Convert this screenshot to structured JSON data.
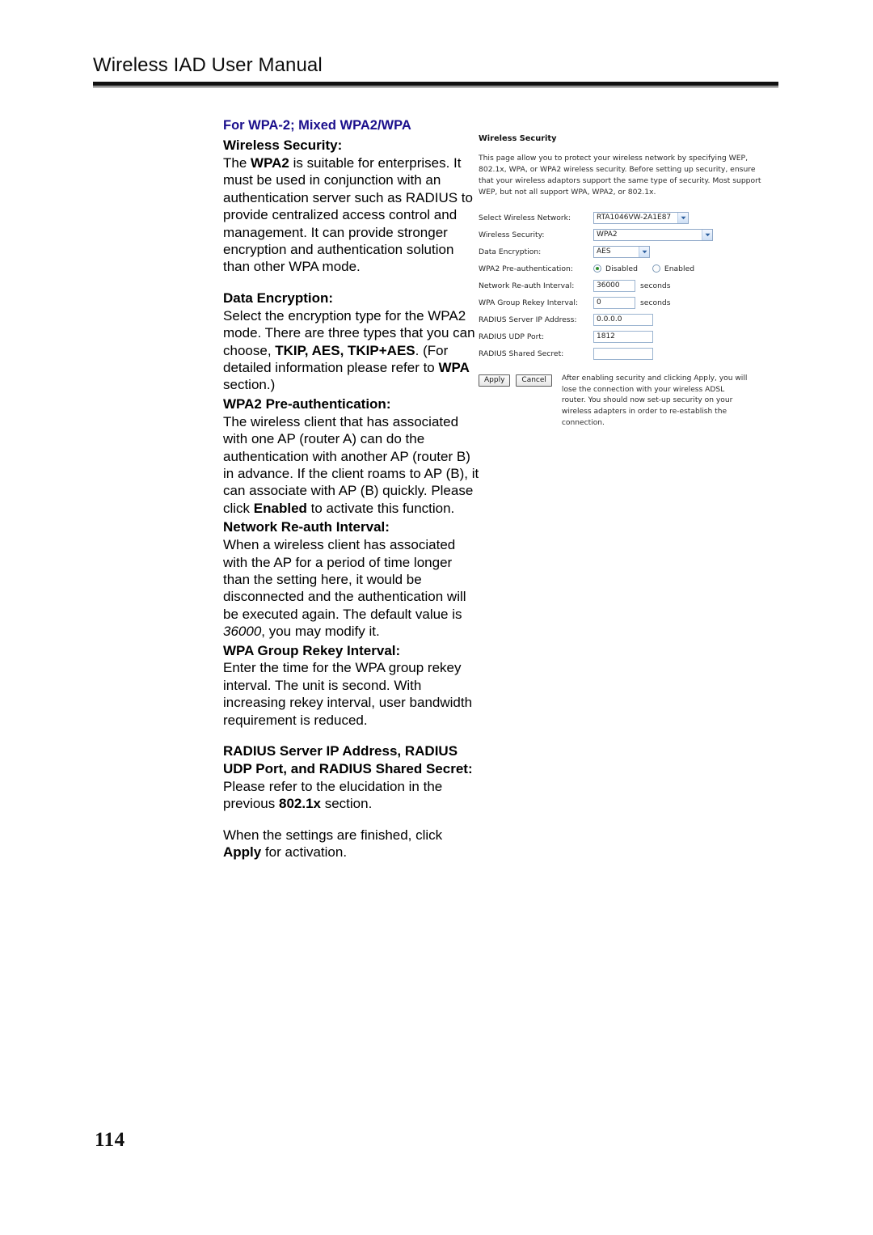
{
  "header": {
    "title": "Wireless IAD User Manual"
  },
  "page_number": "114",
  "doc": {
    "section_title": "For WPA-2; Mixed WPA2/WPA",
    "blocks": [
      {
        "heading": "Wireless Security:",
        "body_html": "The <b>WPA2</b> is suitable for enterprises. It must be used in conjunction with an authentication server such as RADIUS to provide centralized access control and management. It can provide stronger encryption and authentication solution than other WPA mode."
      },
      {
        "heading": "Data Encryption:",
        "body_html": "Select the encryption type for the WPA2 mode. There are three types that you can choose, <b>TKIP, AES, TKIP+AES</b>. (For detailed information please refer to <b>WPA</b> section.)"
      },
      {
        "heading": "WPA2 Pre-authentication:",
        "body_html": "The wireless client that has associated with one AP (router A) can do the authentication with another AP (router B) in advance. If the client roams to AP (B), it can associate with AP (B) quickly. Please click <b>Enabled</b> to activate this function."
      },
      {
        "heading": "Network Re-auth Interval:",
        "body_html": "When a wireless client has associated with the AP for a period of time longer than the setting here, it would be disconnected and the authentication will be executed again. The default value is <i>36000</i>, you may modify it."
      },
      {
        "heading": "WPA Group Rekey Interval:",
        "heading_colon_plain": true,
        "body_html": "Enter the time for the WPA group rekey interval. The unit is second. With increasing rekey interval, user bandwidth requirement is reduced."
      },
      {
        "heading": "RADIUS Server IP Address, RADIUS UDP Port, and RADIUS Shared Secret:",
        "heading_html": "<b>RADIUS Server IP Address, RADIUS UDP Port,</b> and <b>RADIUS Shared Secret:</b>",
        "body_html": "Please refer to the elucidation in the previous <b>802.1x</b> section."
      },
      {
        "heading": "",
        "body_html": "When the settings are finished, click <b>Apply</b> for activation."
      }
    ]
  },
  "screenshot": {
    "title": "Wireless Security",
    "intro": "This page allow you to protect your wireless network by specifying WEP, 802.1x, WPA, or WPA2 wireless security. Before setting up security, ensure that your wireless adaptors support the same type of security. Most support WEP, but not all support WPA, WPA2, or 802.1x.",
    "fields": {
      "select_network": {
        "label": "Select Wireless Network:",
        "value": "RTA1046VW-2A1E87"
      },
      "wireless_security": {
        "label": "Wireless Security:",
        "value": "WPA2"
      },
      "data_encryption": {
        "label": "Data Encryption:",
        "value": "AES"
      },
      "pre_auth": {
        "label": "WPA2 Pre-authentication:",
        "option_disabled": "Disabled",
        "option_enabled": "Enabled",
        "selected": "Disabled"
      },
      "reauth_interval": {
        "label": "Network Re-auth Interval:",
        "value": "36000",
        "unit": "seconds"
      },
      "group_rekey": {
        "label": "WPA Group Rekey Interval:",
        "value": "0",
        "unit": "seconds"
      },
      "radius_ip": {
        "label": "RADIUS Server IP Address:",
        "value": "0.0.0.0"
      },
      "radius_port": {
        "label": "RADIUS UDP Port:",
        "value": "1812"
      },
      "radius_secret": {
        "label": "RADIUS Shared Secret:",
        "value": ""
      }
    },
    "buttons": {
      "apply": "Apply",
      "cancel": "Cancel"
    },
    "note": "After enabling security and clicking Apply, you will lose the connection with your wireless ADSL router. You should now set-up security on your wireless adapters in order to re-establish the connection."
  },
  "colors": {
    "section_title": "#1b0f8c",
    "rule": "#111111",
    "select_border": "#8fa8c8",
    "radio_selected": "#2f8f2f"
  }
}
